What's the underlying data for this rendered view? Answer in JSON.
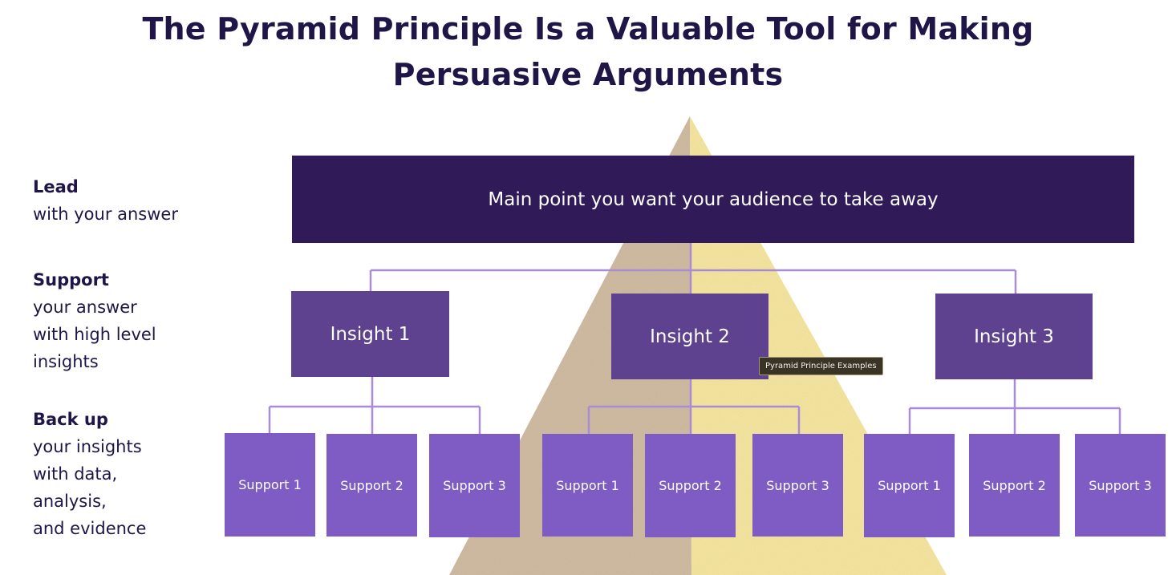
{
  "title": {
    "line1": "The Pyramid Principle Is a Valuable Tool for Making",
    "line2": "Persuasive Arguments"
  },
  "levels": [
    {
      "head": "Lead",
      "body": "with your answer"
    },
    {
      "head": "Support",
      "body": "your answer\nwith high level\ninsights"
    },
    {
      "head": "Back up",
      "body": "your insights\nwith data,\nanalysis,\nand evidence"
    }
  ],
  "main_point": "Main point you want your audience to take away",
  "insights": [
    {
      "label": "Insight 1",
      "supports": [
        "Support 1",
        "Support 2",
        "Support 3"
      ]
    },
    {
      "label": "Insight 2",
      "supports": [
        "Support 1",
        "Support 2",
        "Support 3"
      ]
    },
    {
      "label": "Insight 3",
      "supports": [
        "Support 1",
        "Support 2",
        "Support 3"
      ]
    }
  ],
  "tooltip": "Pyramid Principle Examples",
  "colors": {
    "title_text": "#201547",
    "main_box": "#301b58",
    "insight_box": "#5e428f",
    "support_box": "#7f5bc4",
    "connector": "#a98bd6",
    "pyramid_shadow": "#cdb79c",
    "pyramid_light": "#f5e49a"
  }
}
